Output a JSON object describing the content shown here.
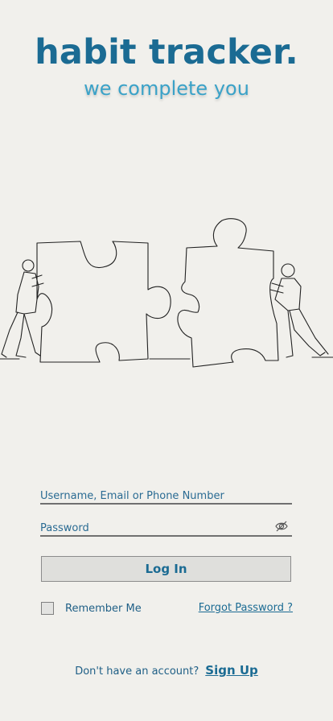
{
  "header": {
    "title": "habit tracker.",
    "tagline": "we complete you"
  },
  "illustration": {
    "description_icon": "puzzle-pieces-people-illustration"
  },
  "form": {
    "username_placeholder": "Username, Email or Phone Number",
    "password_placeholder": "Password",
    "password_toggle_icon": "eye-slash-icon",
    "login_label": "Log In",
    "remember_label": "Remember Me",
    "remember_checked": false,
    "forgot_label": "Forgot Password ?"
  },
  "footer": {
    "prompt": "Don't have an account?",
    "signup_label": "Sign Up"
  },
  "colors": {
    "background": "#f1f0ec",
    "primary": "#1b6b93",
    "accent": "#3aa2c8"
  }
}
